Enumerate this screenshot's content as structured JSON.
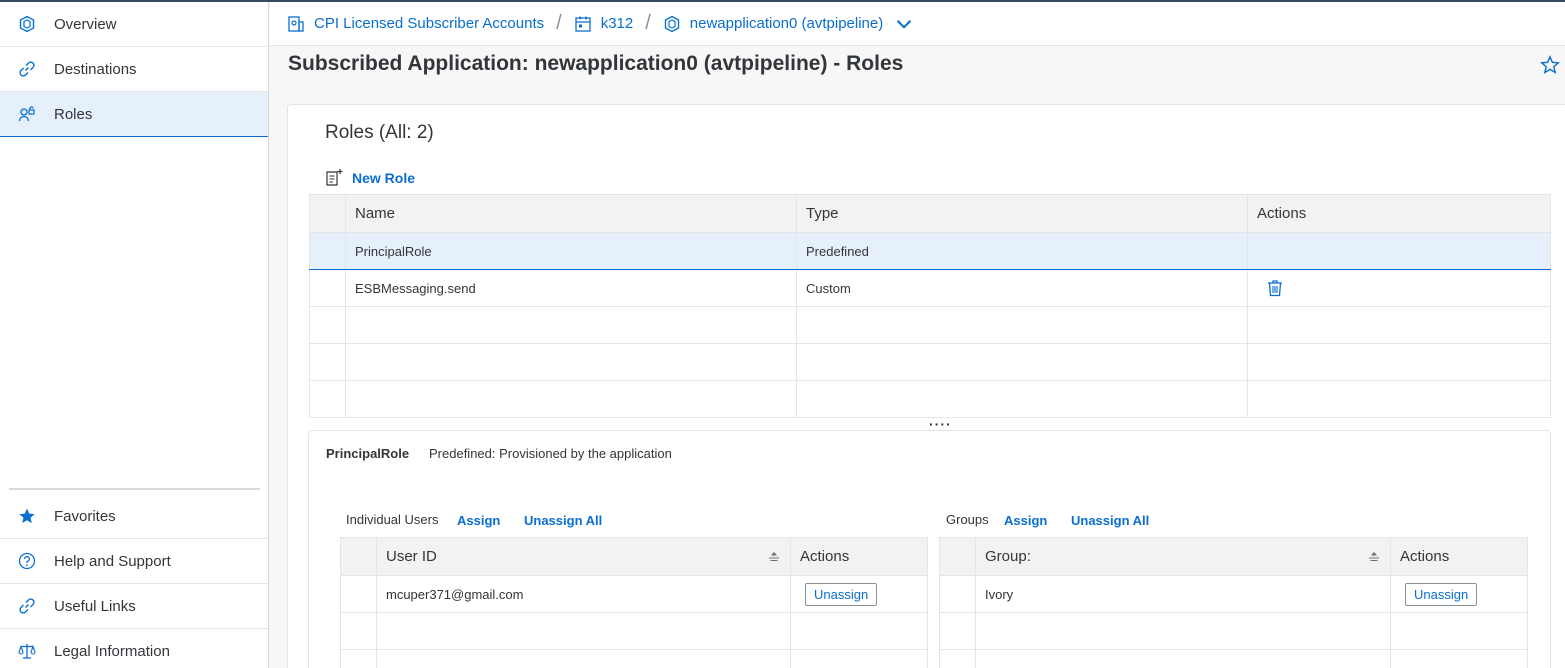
{
  "sidebar": {
    "items": [
      {
        "label": "Overview",
        "icon": "cube-icon"
      },
      {
        "label": "Destinations",
        "icon": "link-icon"
      },
      {
        "label": "Roles",
        "icon": "roles-icon"
      }
    ],
    "bottom": [
      {
        "label": "Favorites",
        "icon": "star-icon"
      },
      {
        "label": "Help and Support",
        "icon": "help-icon"
      },
      {
        "label": "Useful Links",
        "icon": "link-icon"
      },
      {
        "label": "Legal Information",
        "icon": "scale-icon"
      }
    ]
  },
  "breadcrumb": {
    "items": [
      "CPI Licensed Subscriber Accounts",
      "k312",
      "newapplication0 (avtpipeline)"
    ]
  },
  "page": {
    "title": "Subscribed Application: newapplication0 (avtpipeline) - Roles"
  },
  "roles": {
    "title": "Roles (All: 2)",
    "new_role_label": "New Role",
    "columns": [
      "Name",
      "Type",
      "Actions"
    ],
    "rows": [
      {
        "name": "PrincipalRole",
        "type": "Predefined"
      },
      {
        "name": "ESBMessaging.send",
        "type": "Custom"
      }
    ]
  },
  "detail": {
    "role_name": "PrincipalRole",
    "role_desc": "Predefined: Provisioned by the application",
    "users": {
      "label": "Individual Users",
      "assign": "Assign",
      "unassign_all": "Unassign All",
      "columns": [
        "User ID",
        "Actions"
      ],
      "rows": [
        {
          "id": "mcuper371@gmail.com",
          "action": "Unassign"
        }
      ]
    },
    "groups": {
      "label": "Groups",
      "assign": "Assign",
      "unassign_all": "Unassign All",
      "columns": [
        "Group:",
        "Actions"
      ],
      "rows": [
        {
          "group": "Ivory",
          "action": "Unassign"
        }
      ]
    }
  },
  "colors": {
    "accent": "#0a6ed1",
    "selected_bg": "#e5f0fa",
    "text": "#32363a"
  }
}
